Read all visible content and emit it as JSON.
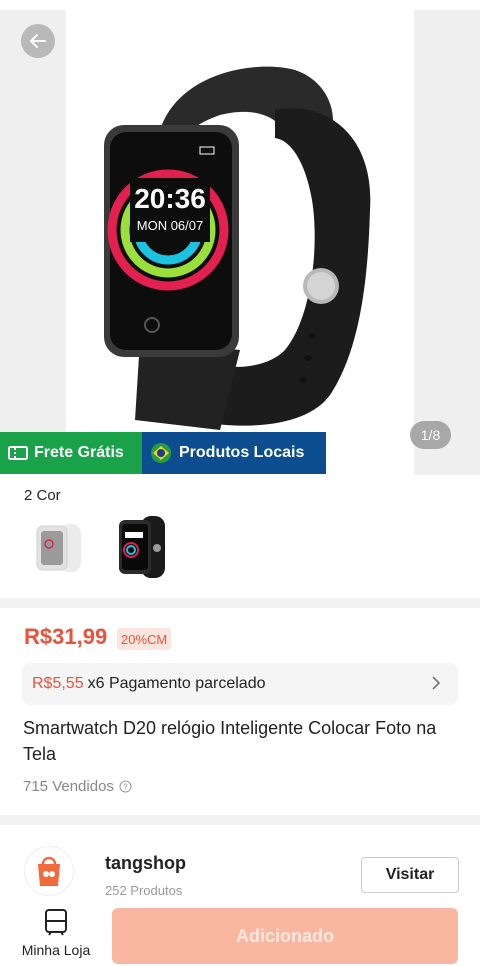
{
  "gallery": {
    "counter": "1/8",
    "watch_time": "20:36",
    "watch_date": "MON 06/07"
  },
  "banner": {
    "free_shipping": "Frete Grátis",
    "local_products": "Produtos Locais"
  },
  "variants": {
    "label": "2 Cor",
    "options": [
      "white",
      "black"
    ]
  },
  "product": {
    "price": "R$31,99",
    "discount_badge": "20%CM",
    "installment_amount": "R$5,55",
    "installment_text": "x6 Pagamento parcelado",
    "title": "Smartwatch D20 relógio Inteligente Colocar Foto na Tela",
    "sold": "715 Vendidos"
  },
  "store": {
    "name": "tangshop",
    "products": "252 Produtos",
    "visit_label": "Visitar"
  },
  "bottom_bar": {
    "my_shop_label": "Minha Loja",
    "add_label": "Adicionado"
  },
  "colors": {
    "accent": "#e8533a",
    "free_shipping_bg": "#1aa24b",
    "local_bg": "#0b4d8f",
    "add_button_bg": "#f9b7a1"
  }
}
